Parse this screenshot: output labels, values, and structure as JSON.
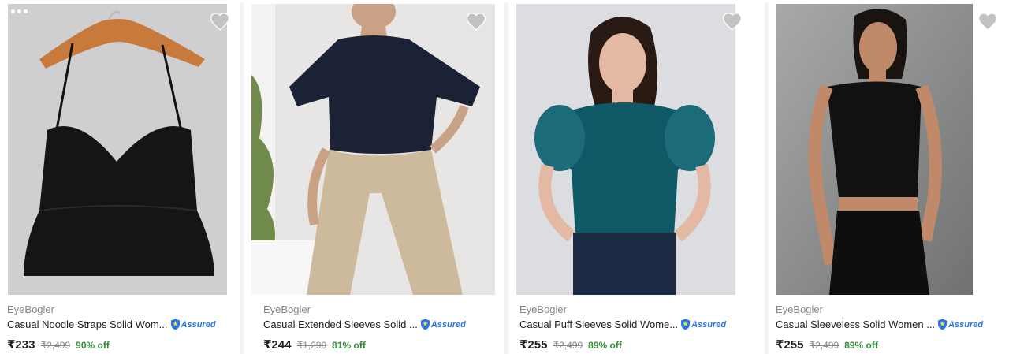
{
  "products": [
    {
      "brand": "EyeBogler",
      "title": "Casual Noodle Straps Solid Wom...",
      "assured_label": "Assured",
      "price": "₹233",
      "mrp": "₹2,499",
      "discount": "90% off",
      "icon": "heart-icon"
    },
    {
      "brand": "EyeBogler",
      "title": "Casual Extended Sleeves Solid ...",
      "assured_label": "Assured",
      "price": "₹244",
      "mrp": "₹1,299",
      "discount": "81% off",
      "icon": "heart-icon"
    },
    {
      "brand": "EyeBogler",
      "title": "Casual Puff Sleeves Solid Wome...",
      "assured_label": "Assured",
      "price": "₹255",
      "mrp": "₹2,499",
      "discount": "89% off",
      "icon": "heart-icon"
    },
    {
      "brand": "EyeBogler",
      "title": "Casual Sleeveless Solid Women ...",
      "assured_label": "Assured",
      "price": "₹255",
      "mrp": "₹2,499",
      "discount": "89% off",
      "icon": "heart-icon"
    }
  ],
  "colors": {
    "accent": "#2874f0",
    "discount": "#388e3c",
    "muted": "#878787",
    "text": "#212121"
  }
}
